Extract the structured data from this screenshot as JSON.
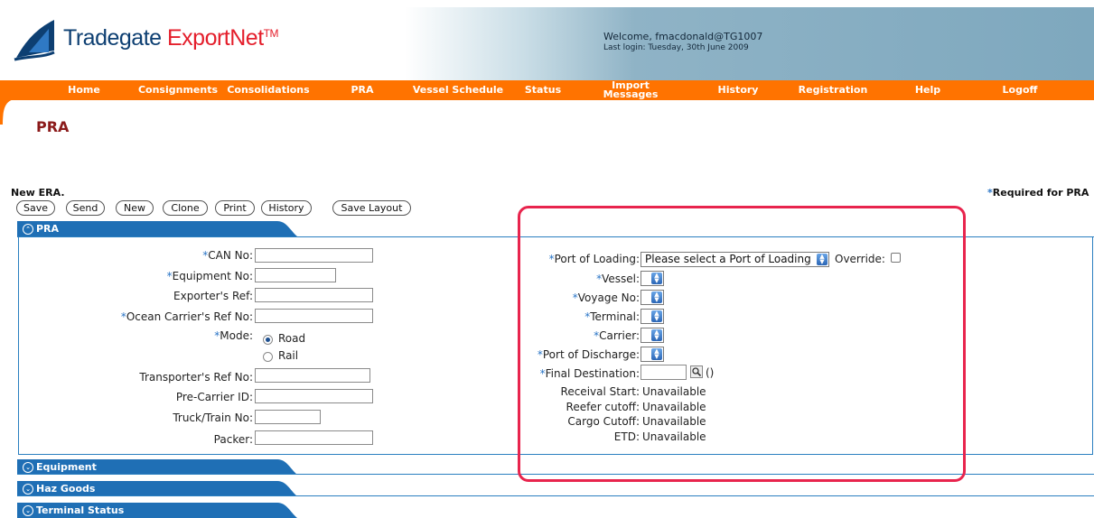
{
  "brand": {
    "name_part1": "Tradegate ",
    "name_part2": "ExportNet",
    "tm": "TM"
  },
  "header": {
    "welcome": "Welcome, fmacdonald@TG1007",
    "last_login": "Last login: Tuesday, 30th June 2009"
  },
  "nav": {
    "home": "Home",
    "consignments": "Consignments",
    "consolidations": "Consolidations",
    "pra": "PRA",
    "vessel_schedule": "Vessel Schedule",
    "status": "Status",
    "import_l1": "Import",
    "import_l2": "Messages",
    "history": "History",
    "registration": "Registration",
    "help": "Help",
    "logoff": "Logoff"
  },
  "page": {
    "title": "PRA",
    "subtitle": "New ERA.",
    "required_star": "*",
    "required_note": "Required for PRA"
  },
  "toolbar": {
    "save": "Save",
    "send": "Send",
    "new": "New",
    "clone": "Clone",
    "print": "Print",
    "history": "History",
    "save_layout": "Save Layout"
  },
  "sections": {
    "pra": "PRA",
    "equipment": "Equipment",
    "haz_goods": "Haz Goods",
    "terminal_status": "Terminal Status"
  },
  "left_form": {
    "can_no": "CAN No:",
    "equipment_no": "Equipment No:",
    "exporters_ref": "Exporter's Ref:",
    "ocean_carrier_ref": "Ocean Carrier's Ref No:",
    "mode": "Mode:",
    "mode_road": "Road",
    "mode_rail": "Rail",
    "transporter_ref": "Transporter's Ref No:",
    "pre_carrier_id": "Pre-Carrier ID:",
    "truck_train_no": "Truck/Train No:",
    "packer": "Packer:"
  },
  "right_form": {
    "port_of_loading": "Port of Loading:",
    "port_of_loading_value": "Please select a Port of Loading",
    "override": "Override:",
    "vessel": "Vessel:",
    "voyage_no": "Voyage No:",
    "terminal": "Terminal:",
    "carrier": "Carrier:",
    "port_of_discharge": "Port of Discharge:",
    "final_destination": "Final Destination:",
    "final_destination_extra": "()",
    "receival_start": "Receival Start:",
    "reefer_cutoff": "Reefer cutoff:",
    "cargo_cutoff": "Cargo Cutoff:",
    "etd": "ETD:",
    "unavailable": "Unavailable"
  },
  "colors": {
    "nav_orange": "#ff7300",
    "section_blue": "#1f6fb5",
    "title_red": "#8b1a1a",
    "highlight": "#e8244d",
    "required_star": "#2a75c6"
  }
}
